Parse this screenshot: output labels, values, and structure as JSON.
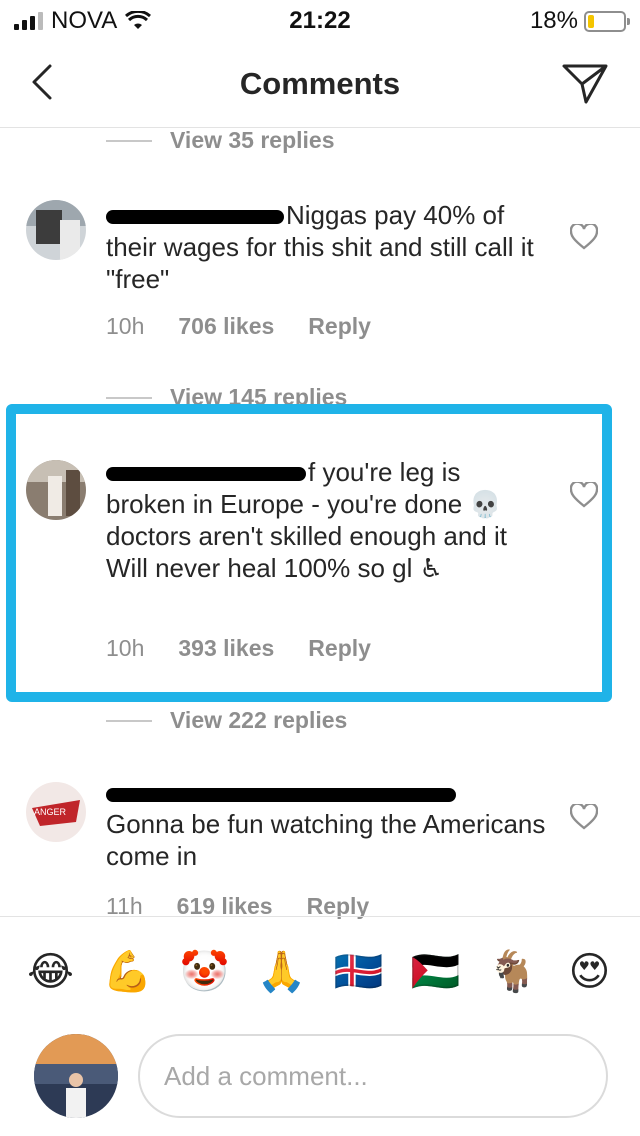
{
  "status_bar": {
    "carrier": "NOVA",
    "time": "21:22",
    "battery": "18%",
    "battery_level": 0.18
  },
  "header": {
    "title": "Comments"
  },
  "threads": [
    {
      "view_replies": "View 35 replies"
    },
    {
      "view_replies": "View 145 replies"
    },
    {
      "view_replies": "View 222 replies"
    }
  ],
  "comments": [
    {
      "text": "Niggas pay 40% of their wages for this shit and still call it \"free\"",
      "time": "10h",
      "likes": "706 likes",
      "reply": "Reply"
    },
    {
      "text": "f you're leg is broken in Europe - you're done 💀  doctors aren't skilled enough and it Will never heal 100% so gl ♿",
      "time": "10h",
      "likes": "393 likes",
      "reply": "Reply"
    },
    {
      "text": "Gonna be fun watching the Americans come in",
      "time": "11h",
      "likes": "619 likes",
      "reply": "Reply",
      "avatar_text": "ANGER"
    }
  ],
  "emoji_bar": [
    "😂",
    "💪",
    "🤡",
    "🙏",
    "🇮🇸",
    "🇵🇸",
    "🐐",
    "😍"
  ],
  "compose": {
    "placeholder": "Add a comment..."
  },
  "colors": {
    "highlight": "#1fb3e8",
    "muted": "#8e8e8e",
    "text": "#262626"
  }
}
